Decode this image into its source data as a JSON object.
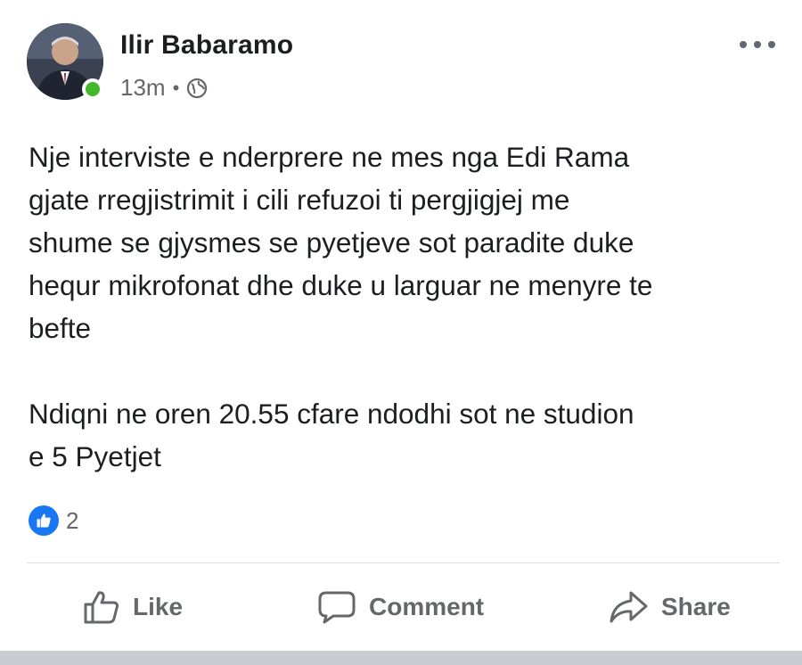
{
  "post": {
    "author": "Ilir Babaramo",
    "time": "13m",
    "separator": "•",
    "privacy_icon": "globe-icon",
    "text_lines_1": [
      "Nje interviste e nderprere ne mes nga Edi Rama",
      "gjate rregjistrimit i cili refuzoi ti pergjigjej me",
      "shume se gjysmes se pyetjeve sot paradite duke",
      "hequr mikrofonat dhe duke u larguar ne menyre te",
      "befte"
    ],
    "text_lines_2": [
      "Ndiqni ne oren 20.55 cfare ndodhi sot ne studion",
      "e 5 Pyetjet"
    ],
    "reaction_count": "2"
  },
  "actions": {
    "like_label": "Like",
    "comment_label": "Comment",
    "share_label": "Share"
  },
  "colors": {
    "accent": "#1877f2",
    "online": "#42b72a",
    "muted_text": "#65676b"
  }
}
